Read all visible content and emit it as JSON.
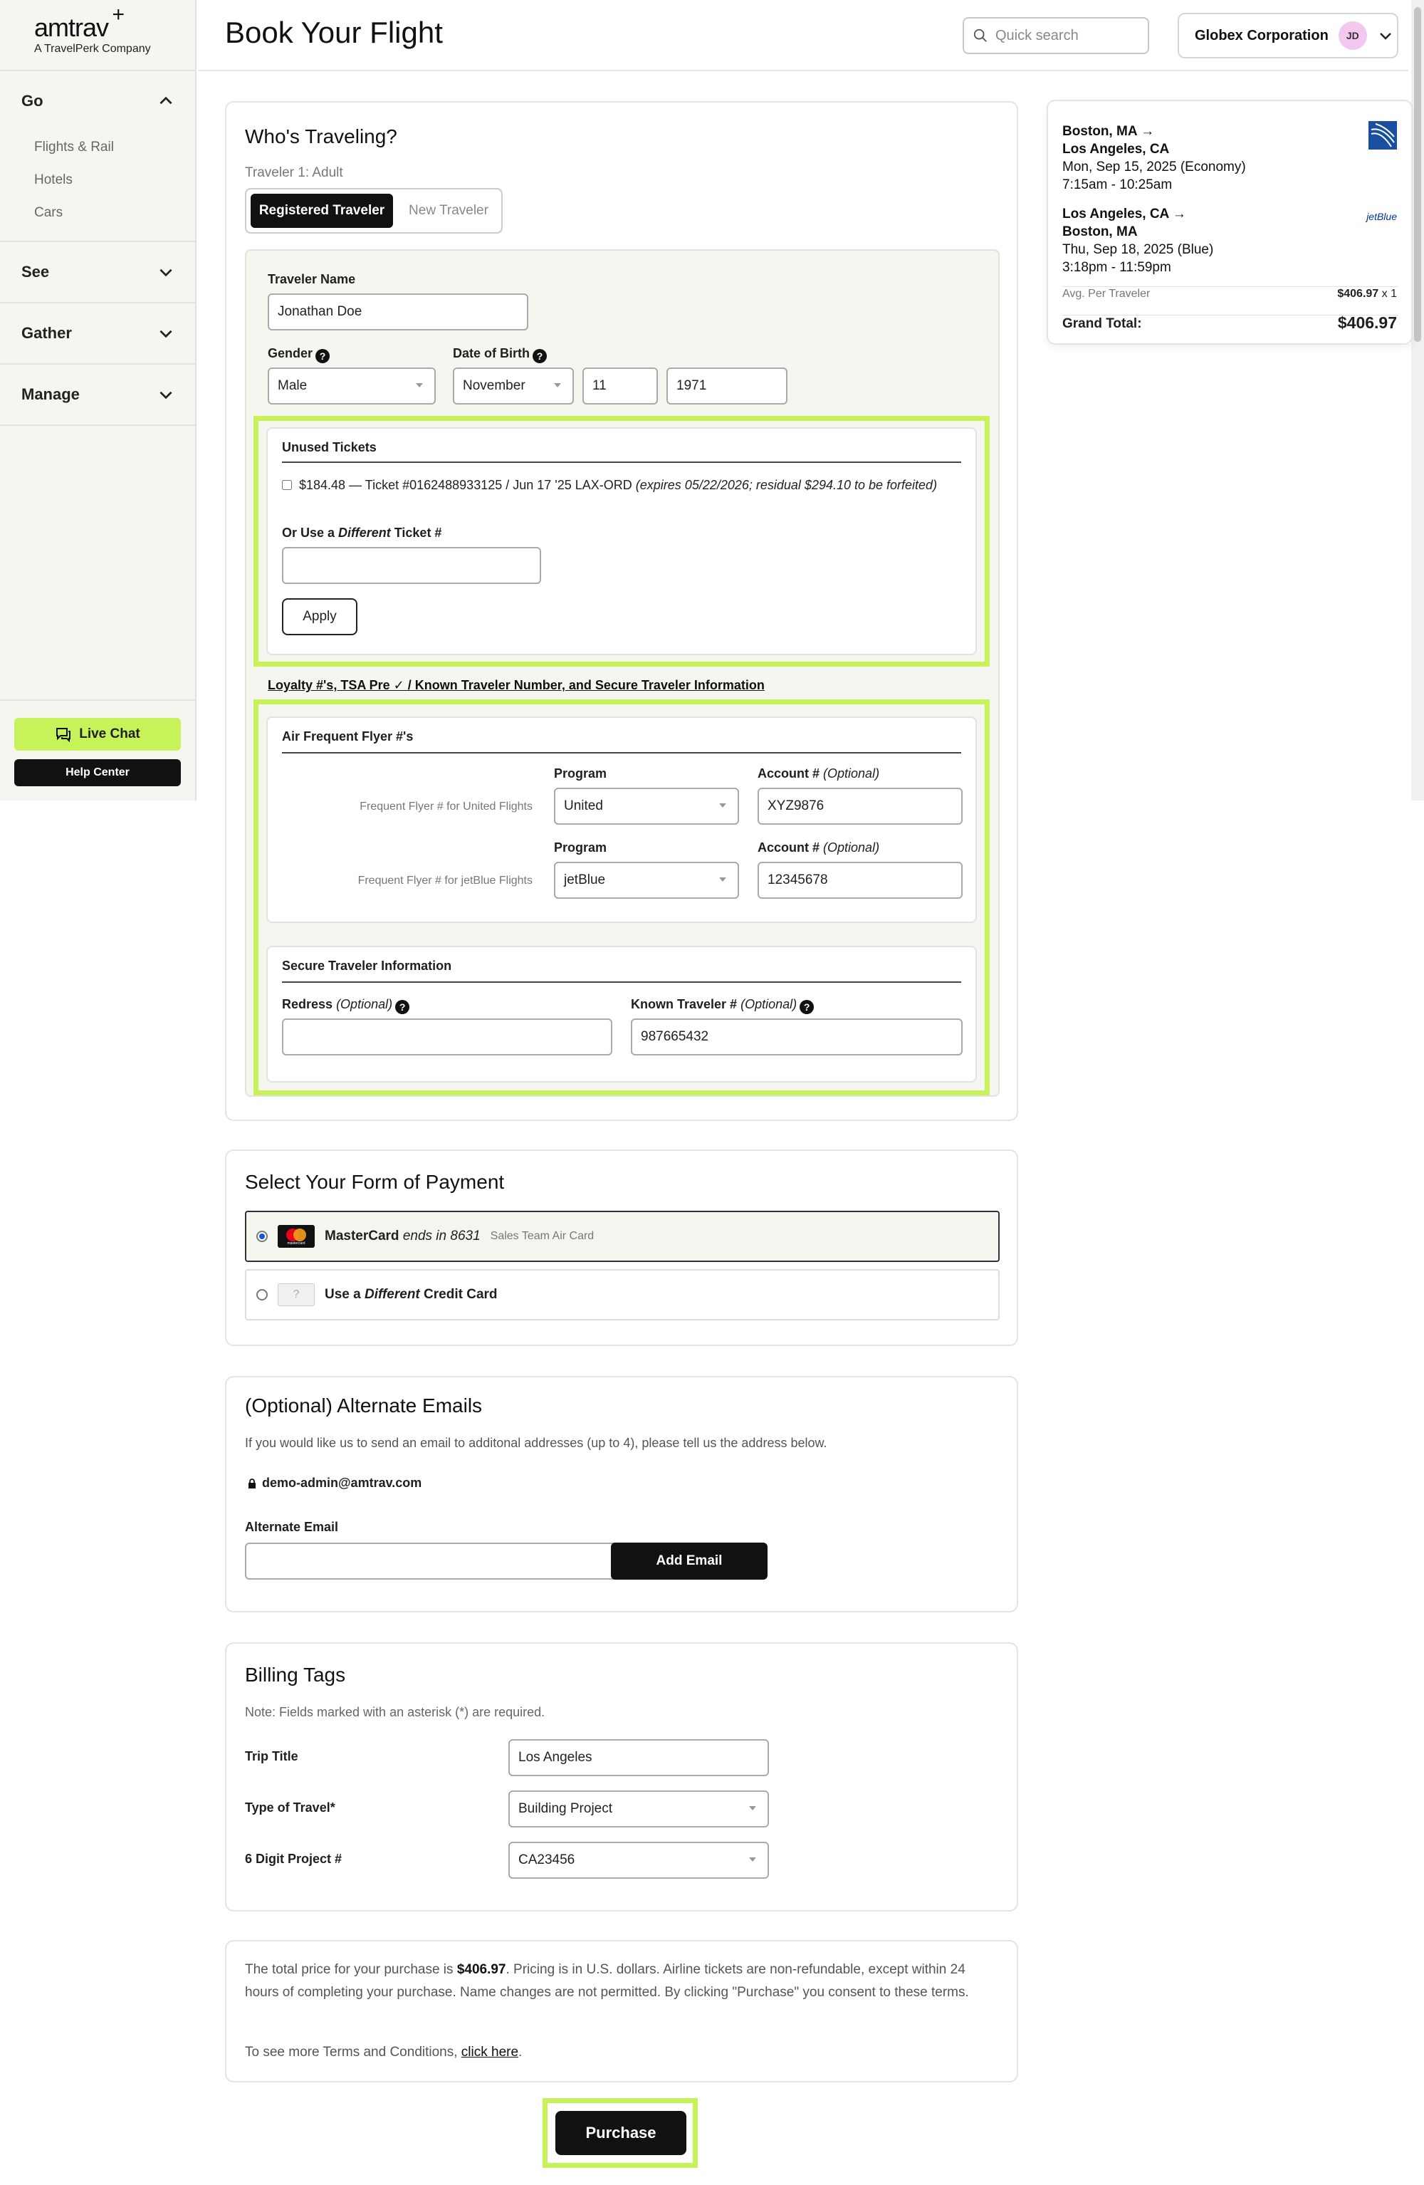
{
  "brand": {
    "name": "amtrav",
    "plus": "+",
    "tagline": "A TravelPerk Company"
  },
  "sidebar": {
    "sections": [
      {
        "label": "Go",
        "items": [
          "Flights & Rail",
          "Hotels",
          "Cars"
        ]
      },
      {
        "label": "See"
      },
      {
        "label": "Gather"
      },
      {
        "label": "Manage"
      }
    ],
    "live_chat": "Live Chat",
    "help_center": "Help Center"
  },
  "header": {
    "title": "Book Your Flight",
    "search_placeholder": "Quick search",
    "org": "Globex Corporation",
    "avatar": "JD"
  },
  "traveler": {
    "title": "Who's Traveling?",
    "traveler_label": "Traveler 1: Adult",
    "toggle": [
      "Registered Traveler",
      "New Traveler"
    ],
    "name_label": "Traveler Name",
    "name_value": "Jonathan Doe",
    "gender_label": "Gender",
    "gender_value": "Male",
    "dob_label": "Date of Birth",
    "dob_month": "November",
    "dob_day": "11",
    "dob_year": "1971",
    "unused": {
      "title": "Unused Tickets",
      "ticket_text": "$184.48 — Ticket #0162488933125 / Jun 17 '25 LAX-ORD",
      "ticket_note": "(expires 05/22/2026; residual $294.10 to be forfeited)",
      "diff_label_a": "Or Use a ",
      "diff_label_em": "Different",
      "diff_label_b": " Ticket #",
      "apply": "Apply"
    },
    "loyalty_link": "Loyalty #'s, TSA Pre ✓ / Known Traveler Number, and Secure Traveler Information",
    "ff": {
      "title": "Air Frequent Flyer #'s",
      "program_label": "Program",
      "account_label": "Account #",
      "optional": "(Optional)",
      "rows": [
        {
          "caption": "Frequent Flyer # for United Flights",
          "program": "United",
          "account": "XYZ9876"
        },
        {
          "caption": "Frequent Flyer # for jetBlue Flights",
          "program": "jetBlue",
          "account": "12345678"
        }
      ]
    },
    "secure": {
      "title": "Secure Traveler Information",
      "redress_label": "Redress",
      "ktn_label": "Known Traveler #",
      "optional": "(Optional)",
      "redress_value": "",
      "ktn_value": "987665432"
    }
  },
  "payment": {
    "title": "Select Your Form of Payment",
    "card_name": "MasterCard",
    "card_ends": "ends in 8631",
    "card_tag": "Sales Team Air Card",
    "card_logo_text": "mastercard",
    "other_a": "Use a ",
    "other_em": "Different",
    "other_b": " Credit Card",
    "other_icon": "?"
  },
  "emails": {
    "title": "(Optional) Alternate Emails",
    "desc": "If you would like us to send an email to additonal addresses (up to 4), please tell us the address below.",
    "locked_email": "demo-admin@amtrav.com",
    "alt_label": "Alternate Email",
    "add_button": "Add Email"
  },
  "billing": {
    "title": "Billing Tags",
    "note": "Note: Fields marked with an asterisk (*) are required.",
    "rows": [
      {
        "label": "Trip Title",
        "value": "Los Angeles"
      },
      {
        "label": "Type of Travel*",
        "value": "Building Project"
      },
      {
        "label": "6 Digit Project #",
        "value": "CA23456"
      }
    ]
  },
  "terms": {
    "p1_a": "The total price for your purchase is ",
    "p1_price": "$406.97",
    "p1_b": ". Pricing is in U.S. dollars. Airline tickets are non-refundable, except within 24 hours of completing your purchase. Name changes are not permitted. By clicking \"Purchase\" you consent to these terms.",
    "p2_a": "To see more Terms and Conditions, ",
    "p2_link": "click here",
    "p2_b": "."
  },
  "purchase": "Purchase",
  "summary": {
    "leg1": [
      "Boston, MA →",
      "Los Angeles, CA",
      "Mon, Sep 15, 2025 (Economy)",
      "7:15am - 10:25am"
    ],
    "leg2": [
      "Los Angeles, CA →",
      "Boston, MA",
      "Thu, Sep 18, 2025 (Blue)",
      "3:18pm - 11:59pm"
    ],
    "jetblue_logo": "jetBlue",
    "avg_label": "Avg. Per Traveler",
    "avg_value": "$406.97",
    "avg_mult": " x 1",
    "total_label": "Grand Total:",
    "total_value": "$406.97"
  },
  "colors": {
    "accent": "#c8f25a",
    "dark": "#111111",
    "united_blue": "#1a4fa0",
    "jetblue": "#0033a0"
  }
}
